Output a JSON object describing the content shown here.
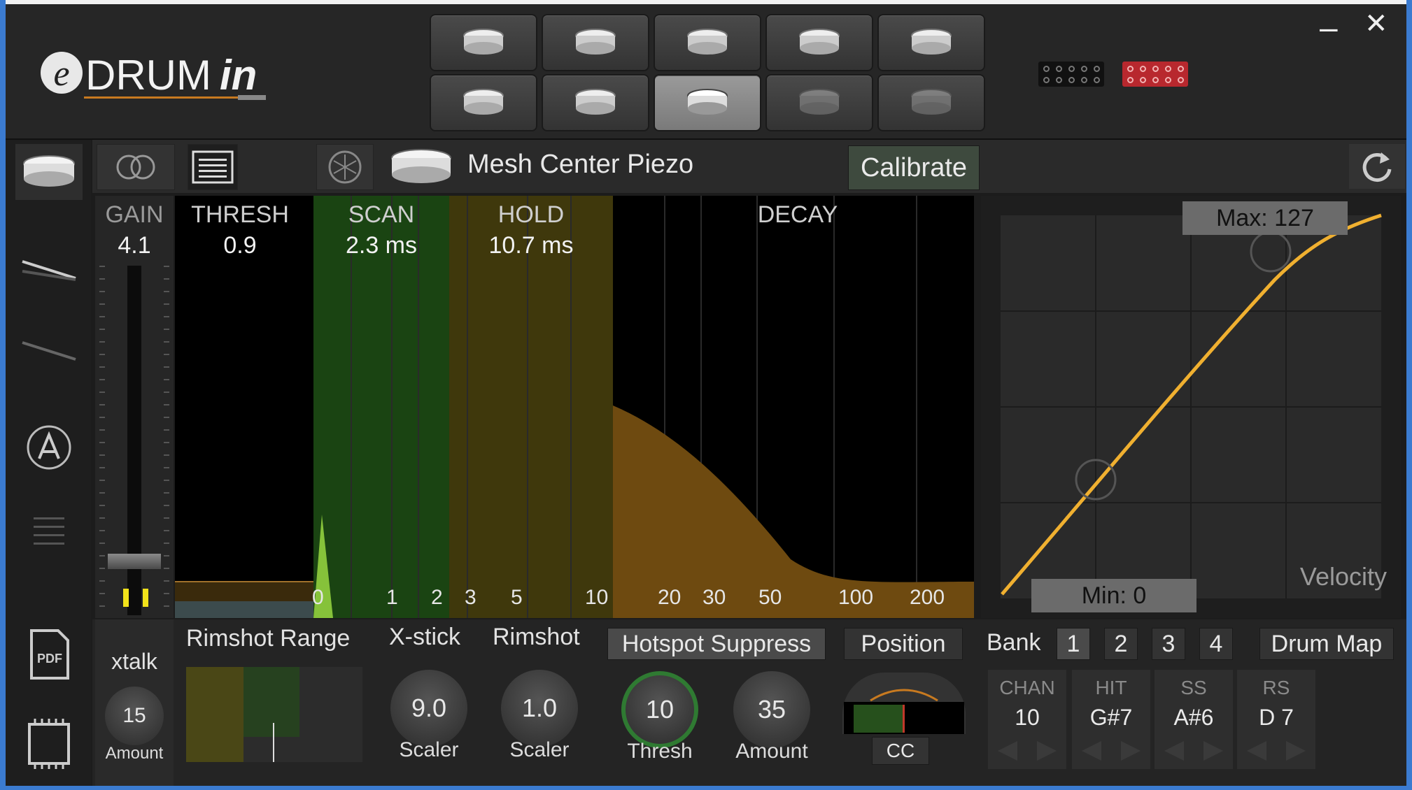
{
  "app": {
    "logo_e": "e",
    "logo_drum": "DRUM",
    "logo_in": "in"
  },
  "window": {
    "minimize": "–",
    "close": "✕"
  },
  "toolbar": {
    "pad_name": "Mesh Center Piezo",
    "calibrate": "Calibrate"
  },
  "gain": {
    "label": "GAIN",
    "value": "4.1"
  },
  "zones": {
    "thresh": {
      "label": "THRESH",
      "value": "0.9"
    },
    "scan": {
      "label": "SCAN",
      "value": "2.3 ms"
    },
    "hold": {
      "label": "HOLD",
      "value": "10.7 ms"
    },
    "decay": {
      "label": "DECAY"
    }
  },
  "time_ticks": [
    "0",
    "1",
    "2",
    "3",
    "5",
    "10",
    "20",
    "30",
    "50",
    "100",
    "200"
  ],
  "velocity": {
    "max_label": "Max: 127",
    "min_label": "Min: 0",
    "caption": "Velocity"
  },
  "xtalk": {
    "label": "xtalk",
    "value": "15",
    "sub": "Amount"
  },
  "bottom": {
    "rimshot_range": "Rimshot Range",
    "xstick": {
      "label": "X-stick",
      "value": "9.0",
      "sub": "Scaler"
    },
    "rimshot": {
      "label": "Rimshot",
      "value": "1.0",
      "sub": "Scaler"
    },
    "hotspot": {
      "label": "Hotspot Suppress",
      "thresh_value": "10",
      "thresh_sub": "Thresh",
      "amount_value": "35",
      "amount_sub": "Amount"
    },
    "position": {
      "label": "Position",
      "cc": "CC"
    },
    "bank": {
      "label": "Bank",
      "items": [
        "1",
        "2",
        "3",
        "4"
      ]
    },
    "drum_map": "Drum Map",
    "cells": [
      {
        "head": "CHAN",
        "value": "10"
      },
      {
        "head": "HIT",
        "value": "G#7"
      },
      {
        "head": "SS",
        "value": "A#6"
      },
      {
        "head": "RS",
        "value": "D 7"
      }
    ]
  },
  "colors": {
    "accent_orange": "#f0b030",
    "scan_green": "#1f4a14",
    "hold_olive": "#4a4010",
    "decay_brown": "#6e4a10",
    "led_active": "#b8282e"
  }
}
